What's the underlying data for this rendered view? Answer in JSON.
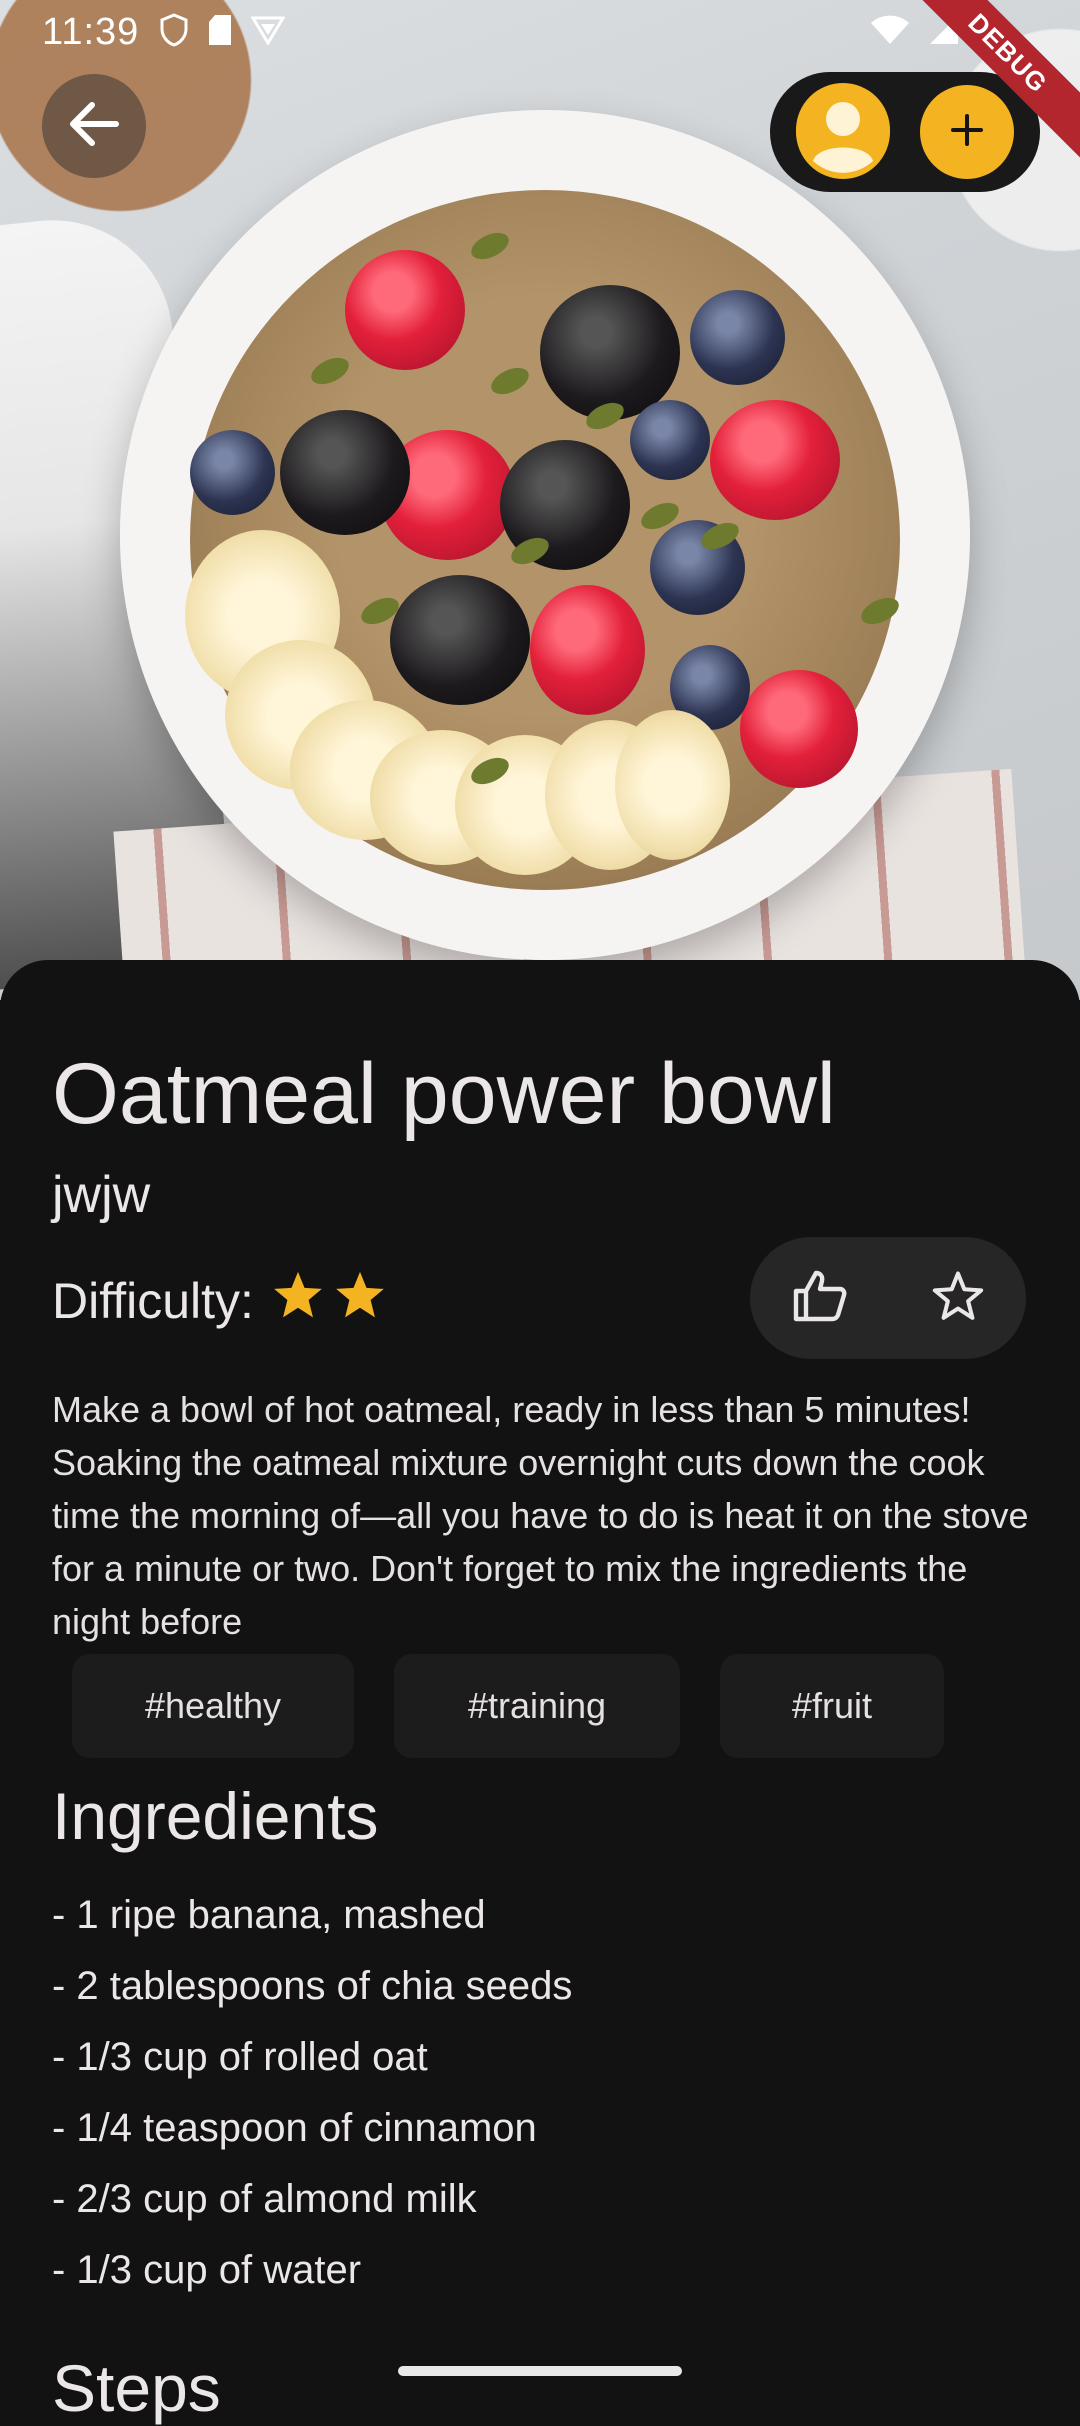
{
  "status_bar": {
    "time": "11:39",
    "debug_label": "DEBUG"
  },
  "icons": {
    "back": "arrow-left-icon",
    "profile": "person-icon",
    "add": "plus-icon",
    "like": "thumbs-up-icon",
    "favorite": "star-outline-icon",
    "difficulty_star": "star-filled-icon"
  },
  "colors": {
    "accent": "#F4B320",
    "background": "#121212",
    "text": "#ECE7E7"
  },
  "recipe": {
    "title": "Oatmeal power bowl",
    "author": "jwjw",
    "difficulty_label": "Difficulty:",
    "difficulty_stars": 2,
    "description": "Make a  bowl of hot oatmeal, ready in less than 5 minutes! Soaking the oatmeal mixture overnight cuts down the cook time the morning of—all you have to do is heat it on the stove for a minute or two. Don't forget to mix the ingredients the night before",
    "tags": [
      "#healthy",
      "#training",
      "#fruit"
    ],
    "ingredients_heading": "Ingredients",
    "ingredients": [
      "- 1 ripe banana, mashed",
      "- 2 tablespoons of chia seeds",
      "- 1/3 cup of rolled oat",
      "- 1/4 teaspoon of cinnamon",
      "- 2/3 cup of almond milk",
      "- 1/3 cup of water"
    ],
    "steps_heading": "Steps"
  }
}
